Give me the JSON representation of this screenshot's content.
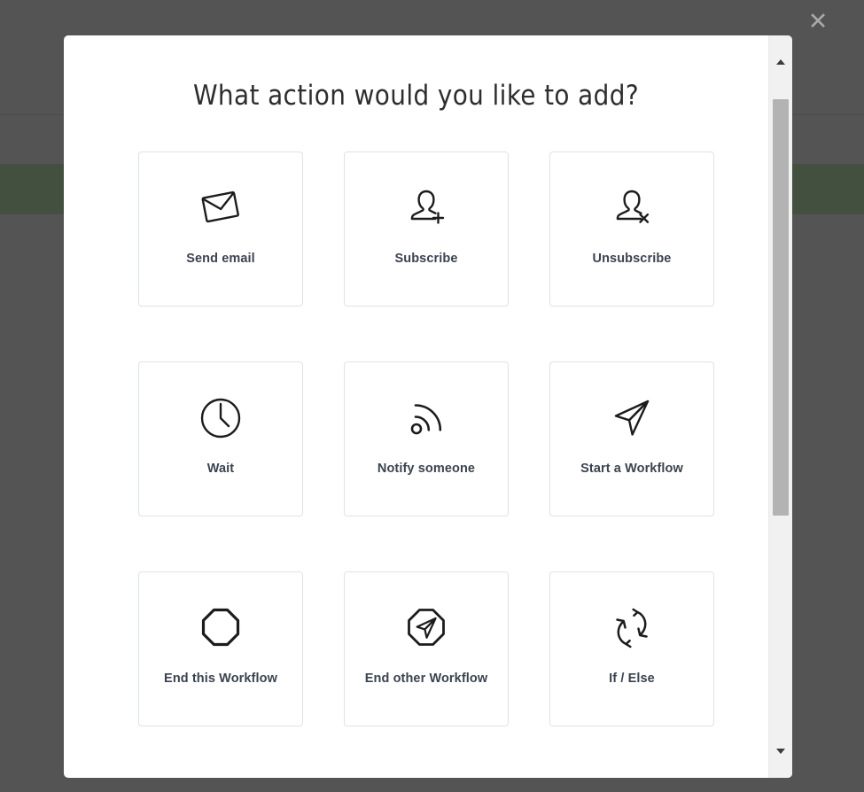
{
  "backdrop": {
    "overlay_color": "#545454",
    "band_color": "#44503f"
  },
  "close_button": {
    "icon": "close-icon",
    "glyph": "✕",
    "color": "#a9a9a9"
  },
  "modal": {
    "title": "What action would you like to add?",
    "background": "#ffffff",
    "border_color": "#dde2ea"
  },
  "actions": [
    {
      "id": "send-email",
      "label": "Send email",
      "icon": "envelope-icon"
    },
    {
      "id": "subscribe",
      "label": "Subscribe",
      "icon": "user-plus-icon"
    },
    {
      "id": "unsubscribe",
      "label": "Unsubscribe",
      "icon": "user-remove-icon"
    },
    {
      "id": "wait",
      "label": "Wait",
      "icon": "clock-icon"
    },
    {
      "id": "notify-someone",
      "label": "Notify someone",
      "icon": "broadcast-signal-icon"
    },
    {
      "id": "start-workflow",
      "label": "Start a Workflow",
      "icon": "paper-plane-icon"
    },
    {
      "id": "end-this-workflow",
      "label": "End this Workflow",
      "icon": "octagon-icon"
    },
    {
      "id": "end-other-workflow",
      "label": "End other Workflow",
      "icon": "octagon-paper-plane-icon"
    },
    {
      "id": "if-else",
      "label": "If / Else",
      "icon": "exchange-arrows-icon"
    }
  ],
  "scrollbar": {
    "track_color": "#f1f1f1",
    "thumb_color": "#b3b3b3",
    "up_arrow": "scroll-up-arrow",
    "down_arrow": "scroll-down-arrow"
  }
}
